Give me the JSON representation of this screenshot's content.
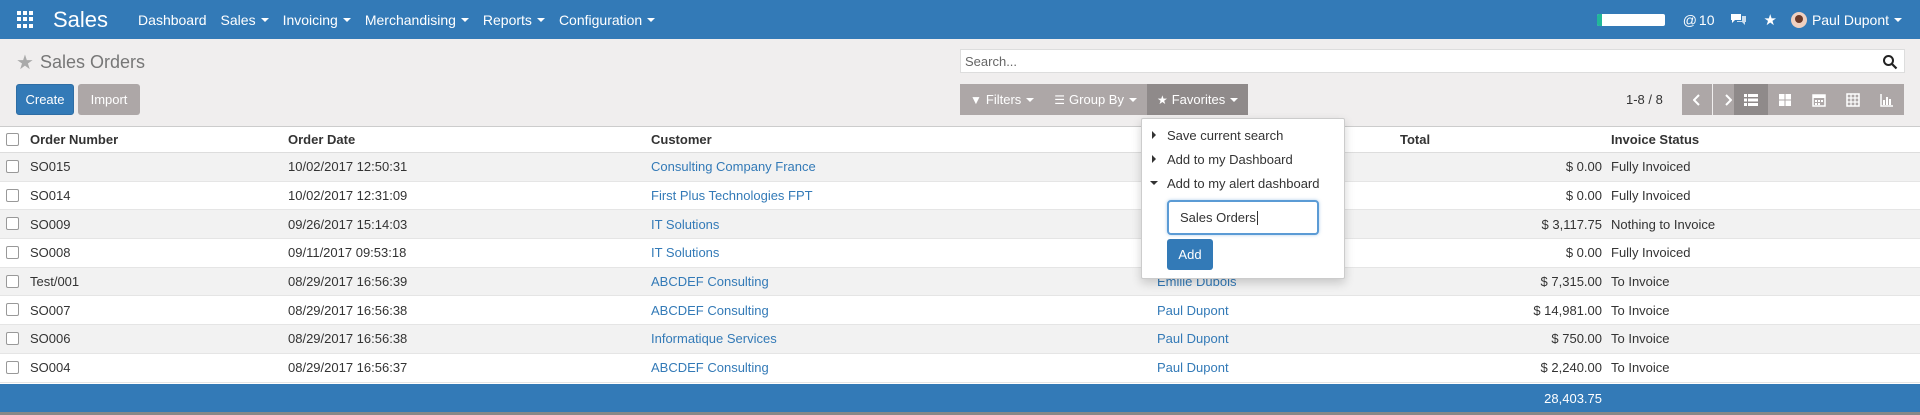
{
  "navbar": {
    "brand": "Sales",
    "menu": [
      {
        "label": "Dashboard",
        "has_caret": false
      },
      {
        "label": "Sales",
        "has_caret": true
      },
      {
        "label": "Invoicing",
        "has_caret": true
      },
      {
        "label": "Merchandising",
        "has_caret": true
      },
      {
        "label": "Reports",
        "has_caret": true
      },
      {
        "label": "Configuration",
        "has_caret": true
      }
    ],
    "progress_fraction": 0.08,
    "activity_count": "10",
    "user_name": "Paul Dupont",
    "accent": "#337ab7"
  },
  "control_panel": {
    "breadcrumb": "Sales Orders",
    "create_label": "Create",
    "import_label": "Import",
    "search_placeholder": "Search...",
    "filters_label": "Filters",
    "groupby_label": "Group By",
    "favorites_label": "Favorites",
    "pager_text": "1-8 / 8",
    "views": [
      "list-view-icon",
      "kanban-view-icon",
      "calendar-view-icon",
      "pivot-view-icon",
      "graph-view-icon"
    ]
  },
  "table": {
    "headers": {
      "number": "Order Number",
      "date": "Order Date",
      "customer": "Customer",
      "salesperson": "",
      "total": "Total",
      "status": "Invoice Status"
    },
    "rows": [
      {
        "number": "SO015",
        "date": "10/02/2017 12:50:31",
        "customer": "Consulting Company France",
        "salesperson": "",
        "total": "$ 0.00",
        "status": "Fully Invoiced"
      },
      {
        "number": "SO014",
        "date": "10/02/2017 12:31:09",
        "customer": "First Plus Technologies FPT",
        "salesperson": "",
        "total": "$ 0.00",
        "status": "Fully Invoiced"
      },
      {
        "number": "SO009",
        "date": "09/26/2017 15:14:03",
        "customer": "IT Solutions",
        "salesperson": "",
        "total": "$ 3,117.75",
        "status": "Nothing to Invoice"
      },
      {
        "number": "SO008",
        "date": "09/11/2017 09:53:18",
        "customer": "IT Solutions",
        "salesperson": "",
        "total": "$ 0.00",
        "status": "Fully Invoiced"
      },
      {
        "number": "Test/001",
        "date": "08/29/2017 16:56:39",
        "customer": "ABCDEF Consulting",
        "salesperson": "Emilie Dubois",
        "total": "$ 7,315.00",
        "status": "To Invoice"
      },
      {
        "number": "SO007",
        "date": "08/29/2017 16:56:38",
        "customer": "ABCDEF Consulting",
        "salesperson": "Paul Dupont",
        "total": "$ 14,981.00",
        "status": "To Invoice"
      },
      {
        "number": "SO006",
        "date": "08/29/2017 16:56:38",
        "customer": "Informatique Services",
        "salesperson": "Paul Dupont",
        "total": "$ 750.00",
        "status": "To Invoice"
      },
      {
        "number": "SO004",
        "date": "08/29/2017 16:56:37",
        "customer": "ABCDEF Consulting",
        "salesperson": "Paul Dupont",
        "total": "$ 2,240.00",
        "status": "To Invoice"
      }
    ],
    "total_sum": "28,403.75"
  },
  "favorites_dropdown": {
    "save_current_search": "Save current search",
    "add_to_dashboard": "Add to my Dashboard",
    "add_to_alert_dashboard": "Add to my alert dashboard",
    "dashboard_name_value": "Sales Orders",
    "add_button": "Add"
  }
}
